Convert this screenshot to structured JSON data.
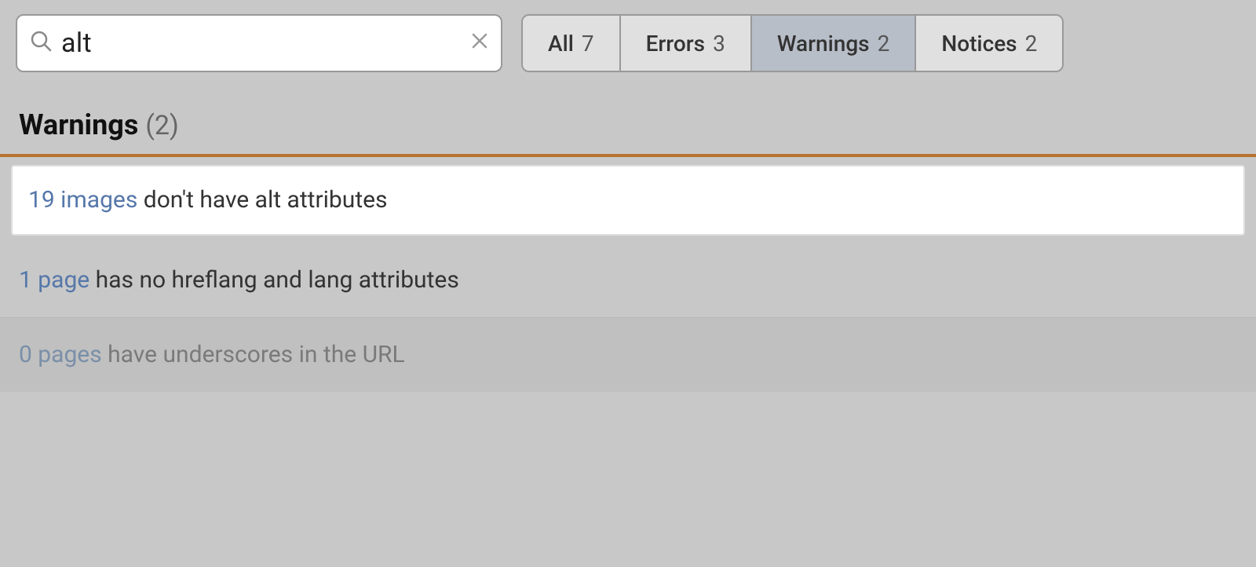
{
  "header": {
    "search": {
      "value": "alt",
      "placeholder": "Search"
    },
    "tabs": [
      {
        "id": "all",
        "label": "All",
        "count": "7",
        "active": false
      },
      {
        "id": "errors",
        "label": "Errors",
        "count": "3",
        "active": false
      },
      {
        "id": "warnings",
        "label": "Warnings",
        "count": "2",
        "active": true
      },
      {
        "id": "notices",
        "label": "Notices",
        "count": "2",
        "active": false
      }
    ]
  },
  "section": {
    "title": "Warnings",
    "count": "(2)"
  },
  "results": [
    {
      "id": "result-1",
      "highlighted": true,
      "link_text": "19 images",
      "rest_text": " don't have alt attributes"
    },
    {
      "id": "result-2",
      "highlighted": false,
      "link_text": "1 page",
      "rest_text": " has no hreflang and lang attributes"
    },
    {
      "id": "result-3",
      "highlighted": false,
      "faded": true,
      "link_text": "0 pages",
      "rest_text": " have underscores in the URL"
    }
  ],
  "colors": {
    "warning_divider": "#b87333",
    "active_tab_bg": "#b8bec8",
    "background": "#c8c8c8",
    "link_color": "#5577aa",
    "faded_link_color": "#7a8fa8",
    "faded_text": "#7a7a7a"
  },
  "icons": {
    "search": "🔍",
    "clear": "×"
  }
}
